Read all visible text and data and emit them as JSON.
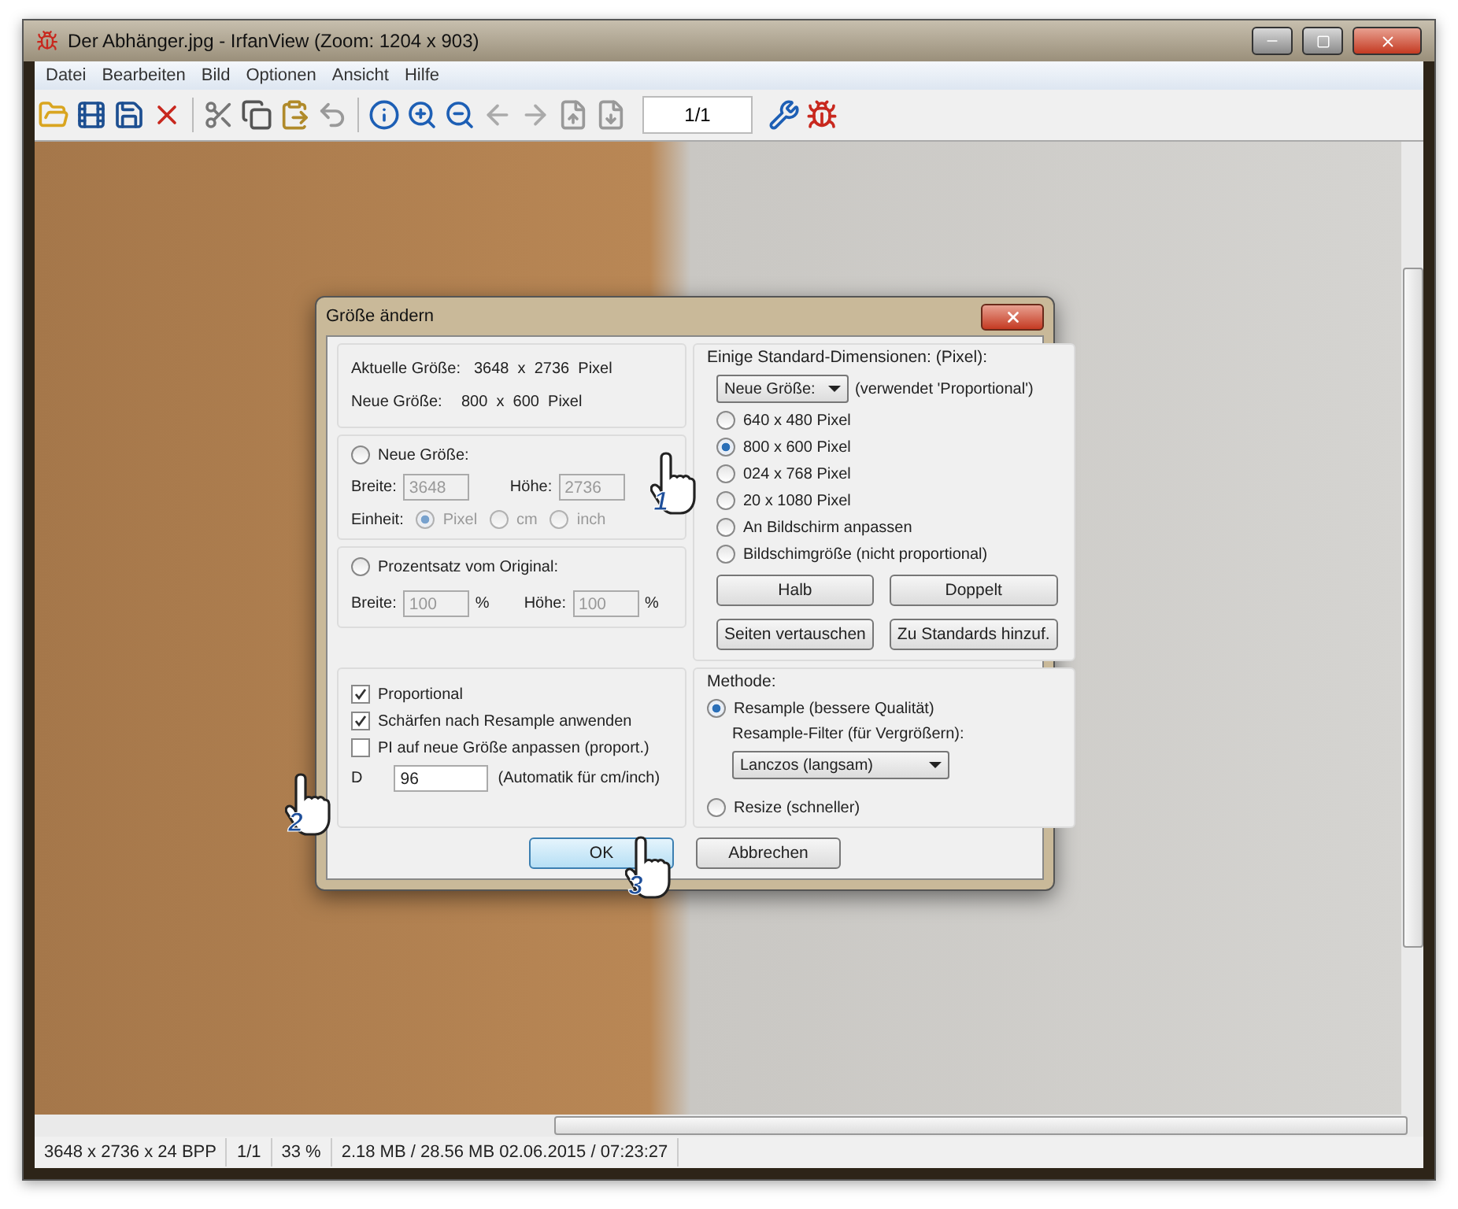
{
  "window": {
    "title": "Der Abhänger.jpg - IrfanView (Zoom: 1204 x 903)"
  },
  "menu": [
    "Datei",
    "Bearbeiten",
    "Bild",
    "Optionen",
    "Ansicht",
    "Hilfe"
  ],
  "toolbar": {
    "page_field": "1/1"
  },
  "dialog": {
    "title": "Größe ändern",
    "info": [
      {
        "label": "Aktuelle Größe:",
        "value": "3648  x  2736  Pixel"
      },
      {
        "label": "Neue Größe:",
        "value": "800  x  600  Pixel"
      }
    ],
    "new_size": {
      "label": "Neue Größe:",
      "selected": false,
      "fields": [
        {
          "label": "Breite:",
          "value": "3648",
          "disabled": true
        },
        {
          "label": "Höhe:",
          "value": "2736",
          "disabled": true
        }
      ],
      "unit_label": "Einheit:",
      "units": [
        {
          "label": "Pixel",
          "selected": true
        },
        {
          "label": "cm",
          "selected": false
        },
        {
          "label": "inch",
          "selected": false
        }
      ]
    },
    "percent": {
      "label": "Prozentsatz vom Original:",
      "selected": false,
      "fields": [
        {
          "label": "Breite:",
          "value": "100",
          "unit": "%",
          "disabled": true
        },
        {
          "label": "Höhe:",
          "value": "100",
          "unit": "%",
          "disabled": true
        }
      ]
    },
    "options": [
      {
        "label": "Proportional",
        "checked": true
      },
      {
        "label": "Schärfen nach Resample anwenden",
        "checked": true
      },
      {
        "label": "PI auf neue Größe anpassen (proport.)",
        "checked": false
      }
    ],
    "dpi": {
      "label": "D",
      "value": "96",
      "note": "(Automatik für cm/inch)"
    },
    "standard": {
      "label": "Einige Standard-Dimensionen: (Pixel):",
      "dropdown": "Neue Größe:",
      "dropdown_note": "(verwendet 'Proportional')",
      "presets": [
        {
          "label": "640 x 480 Pixel",
          "selected": false
        },
        {
          "label": "800 x 600 Pixel",
          "selected": true
        },
        {
          "label": "024 x 768 Pixel",
          "selected": false
        },
        {
          "label": "20 x 1080 Pixel",
          "selected": false
        },
        {
          "label": "An Bildschirm anpassen",
          "selected": false
        },
        {
          "label": "Bildschimgröße (nicht proportional)",
          "selected": false
        }
      ],
      "buttons": [
        "Halb",
        "Doppelt",
        "Seiten vertauschen",
        "Zu Standards hinzuf."
      ]
    },
    "method": {
      "label": "Methode:",
      "options": [
        {
          "label": "Resample (bessere Qualität)",
          "selected": true
        },
        {
          "label": "Resize (schneller)",
          "selected": false
        }
      ],
      "filter_label": "Resample-Filter (für Vergrößern):",
      "filter_value": "Lanczos (langsam)"
    },
    "buttons": [
      {
        "label": "OK",
        "default": true
      },
      {
        "label": "Abbrechen",
        "default": false
      }
    ],
    "cursors": [
      {
        "badge": "1"
      },
      {
        "badge": "2"
      },
      {
        "badge": "3"
      }
    ]
  },
  "status_bar": [
    "3648 x 2736 x 24 BPP",
    "1/1",
    "33 %",
    "2.18 MB / 28.56 MB 02.06.2015 / 07:23:27"
  ]
}
